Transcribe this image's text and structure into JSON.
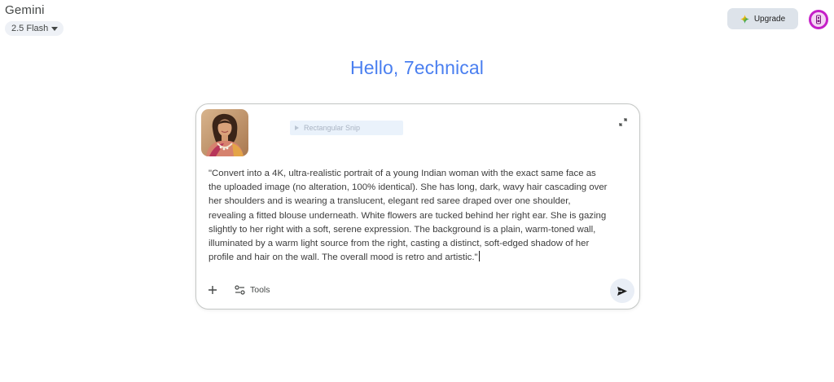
{
  "app": {
    "title": "Gemini",
    "model": "2.5 Flash"
  },
  "header": {
    "upgrade_label": "Upgrade"
  },
  "greeting": "Hello, 7echnical",
  "prompt": {
    "ghost_snip_label": "Rectangular Snip",
    "text": "\"Convert into a 4K, ultra-realistic portrait of a young Indian woman with the exact same face as\nthe uploaded image (no alteration, 100% identical). She has long, dark, wavy hair cascading over\nher shoulders and is wearing a translucent, elegant red saree draped over one shoulder,\nrevealing a fitted blouse underneath. White flowers are tucked behind her right ear. She is gazing\nslightly to her right with a soft, serene expression. The background is a plain, warm-toned wall,\nilluminated by a warm light source from the right, casting a distinct, soft-edged shadow of her\nprofile and hair on the wall. The overall mood is retro and artistic.\"",
    "tools_label": "Tools"
  },
  "icons": {
    "upgrade": "sparkle-icon",
    "expand": "expand-icon",
    "add": "plus-icon",
    "tools": "tune-icon",
    "send": "send-icon"
  },
  "colors": {
    "greeting": "#4a7ff0",
    "avatar_ring": "#c51fc8",
    "upgrade_bg": "#dde3ea",
    "send_bg": "#e9eef6"
  }
}
